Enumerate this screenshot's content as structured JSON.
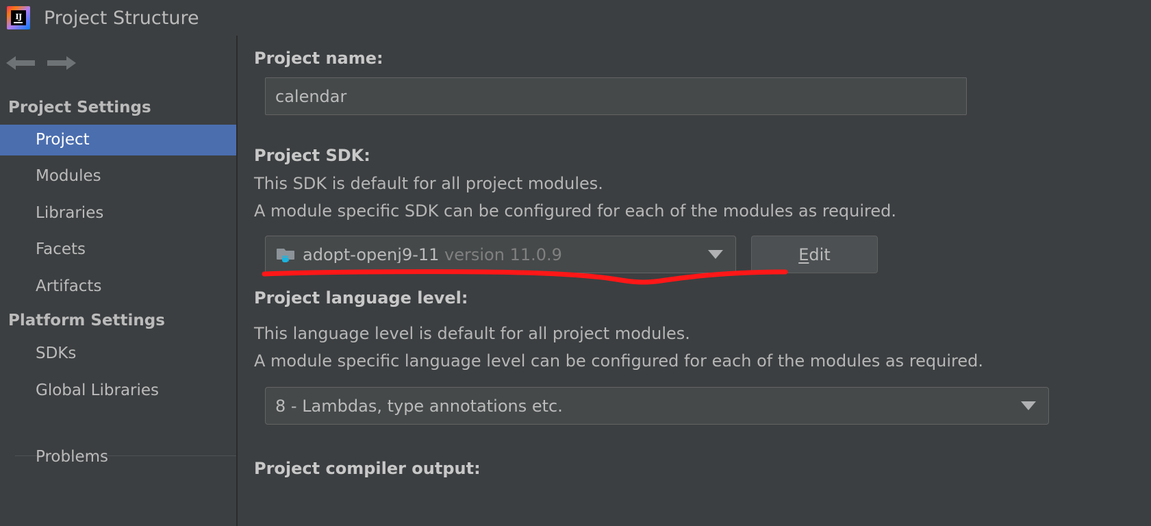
{
  "window": {
    "title": "Project Structure",
    "logo_icon": "intellij-idea-logo",
    "logo_text": "IJ"
  },
  "nav": {
    "back_icon": "arrow-left-icon",
    "forward_icon": "arrow-right-icon"
  },
  "sidebar": {
    "sections": [
      {
        "header": "Project Settings"
      },
      {
        "header": "Platform Settings"
      }
    ],
    "items": [
      {
        "label": "Project",
        "selected": true
      },
      {
        "label": "Modules",
        "selected": false
      },
      {
        "label": "Libraries",
        "selected": false
      },
      {
        "label": "Facets",
        "selected": false
      },
      {
        "label": "Artifacts",
        "selected": false
      },
      {
        "label": "SDKs",
        "selected": false
      },
      {
        "label": "Global Libraries",
        "selected": false
      },
      {
        "label": "Problems",
        "selected": false
      }
    ]
  },
  "main": {
    "project_name": {
      "label": "Project name:",
      "value": "calendar"
    },
    "project_sdk": {
      "label": "Project SDK:",
      "description_line1": "This SDK is default for all project modules.",
      "description_line2": "A module specific SDK can be configured for each of the modules as required.",
      "selected_name": "adopt-openj9-11",
      "selected_version": "version 11.0.9",
      "icon": "jdk-folder-java-icon",
      "chevron_icon": "chevron-down-icon",
      "edit_button": {
        "mnemonic": "E",
        "rest": "dit"
      }
    },
    "project_language_level": {
      "label": "Project language level:",
      "description_line1": "This language level is default for all project modules.",
      "description_line2": "A module specific language level can be configured for each of the modules as required.",
      "selected": "8 - Lambdas, type annotations etc.",
      "chevron_icon": "chevron-down-icon"
    },
    "project_compiler_output": {
      "label": "Project compiler output:"
    }
  },
  "annotation": {
    "name": "red-underline-annotation",
    "color": "#FF0000"
  },
  "colors": {
    "background": "#3C3F41",
    "selection": "#4B6EAF",
    "text": "#BBBBBB",
    "text_dim": "#808080",
    "input_background": "#45494A",
    "border": "#646464",
    "annotation_red": "#FF0000"
  }
}
